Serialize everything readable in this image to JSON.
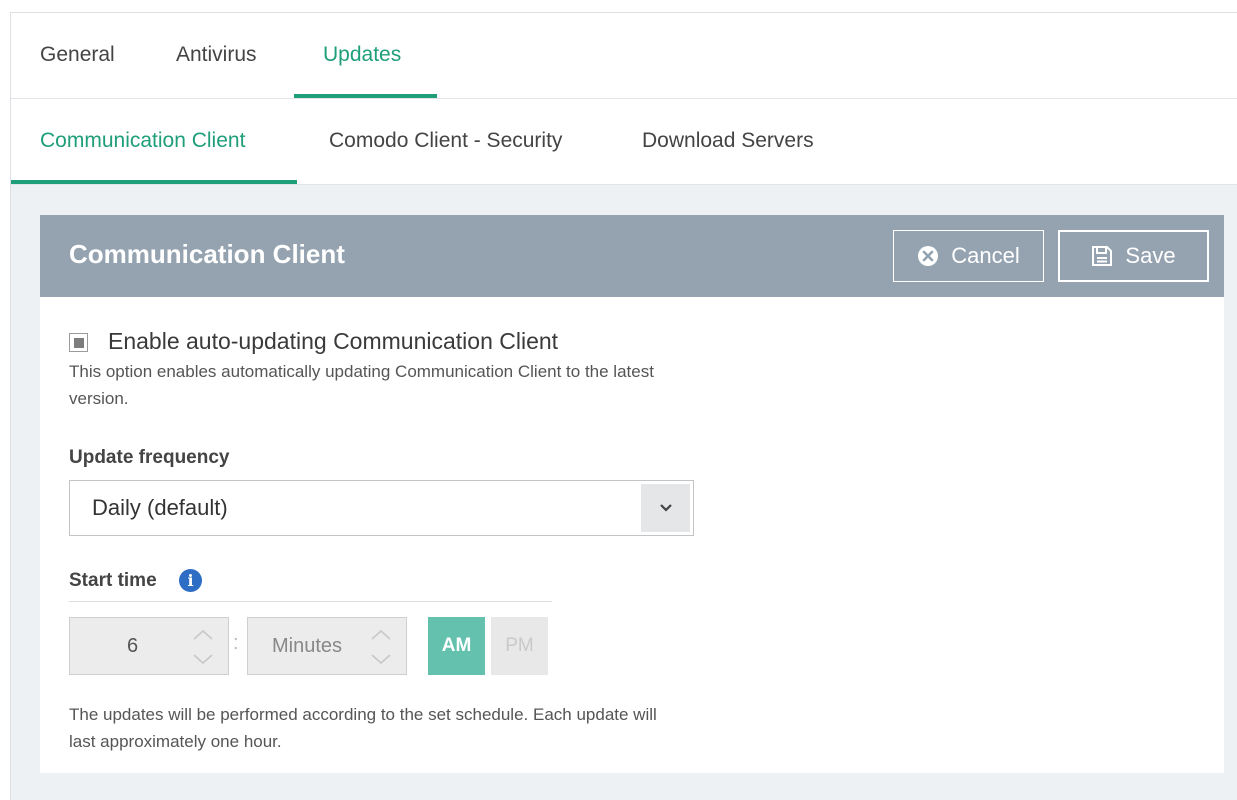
{
  "tabs_main": [
    {
      "label": "General",
      "active": false
    },
    {
      "label": "Antivirus",
      "active": false
    },
    {
      "label": "Updates",
      "active": true
    }
  ],
  "tabs_sub": [
    {
      "label": "Communication Client",
      "active": true
    },
    {
      "label": "Comodo Client - Security",
      "active": false
    },
    {
      "label": "Download Servers",
      "active": false
    }
  ],
  "card": {
    "title": "Communication Client",
    "cancel_label": "Cancel",
    "save_label": "Save",
    "cancel_icon": "x-circle-icon",
    "save_icon": "floppy-disk-icon"
  },
  "auto_update": {
    "checked": true,
    "label": "Enable auto-updating Communication Client",
    "help": "This option enables automatically updating Communication Client to the latest version."
  },
  "frequency": {
    "label": "Update frequency",
    "selected": "Daily (default)"
  },
  "start_time": {
    "label": "Start time",
    "hour": "6",
    "minutes": "Minutes",
    "separator": ":",
    "am_label": "AM",
    "pm_label": "PM",
    "selected_period": "AM",
    "help": "The updates will be performed according to the set schedule. Each update will last approximately one hour."
  },
  "colors": {
    "accent": "#1f9e7a",
    "header_bg": "#95a3b1",
    "am_active": "#63c1ae",
    "info_icon": "#2d6dc4"
  }
}
